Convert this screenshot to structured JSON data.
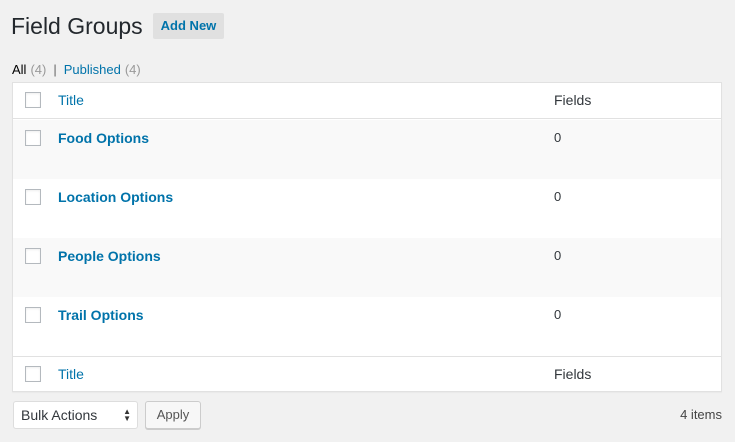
{
  "header": {
    "title": "Field Groups",
    "add_new_label": "Add New"
  },
  "filters": {
    "all_label": "All",
    "all_count": "(4)",
    "separator": "|",
    "published_label": "Published",
    "published_count": "(4)"
  },
  "table": {
    "columns": {
      "title": "Title",
      "fields": "Fields"
    },
    "rows": [
      {
        "title": "Food Options",
        "fields": "0"
      },
      {
        "title": "Location Options",
        "fields": "0"
      },
      {
        "title": "People Options",
        "fields": "0"
      },
      {
        "title": "Trail Options",
        "fields": "0"
      }
    ]
  },
  "footer": {
    "bulk_actions_label": "Bulk Actions",
    "apply_label": "Apply",
    "items_count": "4 items"
  },
  "colors": {
    "link": "#0073aa",
    "background": "#f1f1f1",
    "alt_row": "#f9f9f9"
  }
}
